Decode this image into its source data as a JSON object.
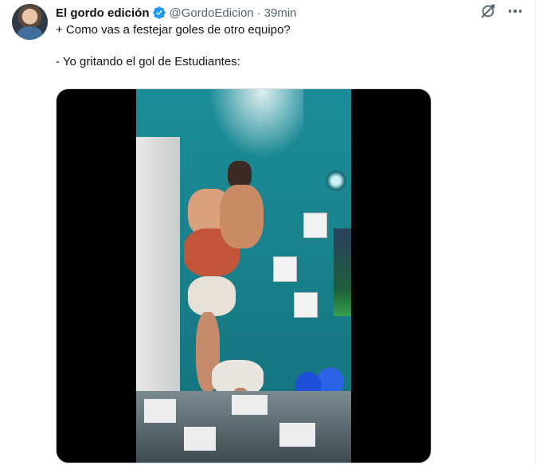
{
  "tweet": {
    "author_name": "El gordo edición",
    "handle": "@GordoEdicion",
    "separator": "·",
    "time": "39min",
    "lines": [
      "+ Como vas a festejar goles de otro equipo?",
      "- Yo gritando el gol de Estudiantes:"
    ]
  },
  "icons": {
    "verified": "verified-badge-icon",
    "grok": "grok-icon",
    "more": "more-options-icon"
  },
  "colors": {
    "verified": "#1d9bf0",
    "text_primary": "#0f1419",
    "text_secondary": "#536471"
  }
}
